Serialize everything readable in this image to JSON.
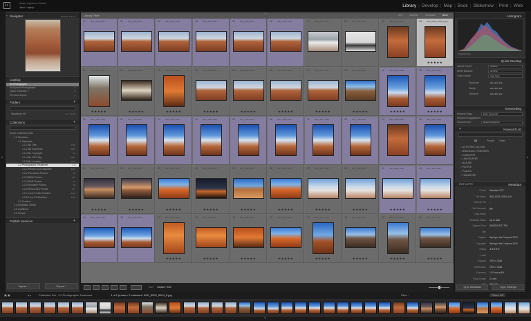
{
  "identity": {
    "user": "Adobe Lightroom Classic",
    "plate": "Jack Laptop"
  },
  "modules": {
    "items": [
      {
        "label": "Library",
        "active": true
      },
      {
        "label": "Develop",
        "active": false
      },
      {
        "label": "Map",
        "active": false
      },
      {
        "label": "Book",
        "active": false
      },
      {
        "label": "Slideshow",
        "active": false
      },
      {
        "label": "Print",
        "active": false
      },
      {
        "label": "Web",
        "active": false
      }
    ]
  },
  "left": {
    "navigator": {
      "title": "Navigator",
      "zoom": [
        "FIT",
        "FILL",
        "1:1",
        "3:1"
      ]
    },
    "catalog": {
      "title": "Catalog",
      "items": [
        {
          "label": "All Photographs",
          "count": "11034"
        },
        {
          "label": "All Synced Photographs",
          "count": "0"
        },
        {
          "label": "Quick Collection +",
          "count": "0"
        },
        {
          "label": "Previous Import",
          "count": "0"
        }
      ]
    },
    "folders": {
      "title": "Folders",
      "volume": "Macintosh HD",
      "volume_info": "1.4 / 1.9 TB"
    },
    "collections": {
      "title": "Collections",
      "items": [
        {
          "label": "Smart Collection Sets",
          "count": ""
        },
        {
          "label": "1.0 Workflow",
          "count": ""
        },
        {
          "label": "1.1 Metadata",
          "count": ""
        },
        {
          "label": "1.1.1 No Title",
          "count": "4459"
        },
        {
          "label": "1.1.2 No Keywords",
          "count": "2057"
        },
        {
          "label": "1.1.3 No Copyright",
          "count": "25"
        },
        {
          "label": "1.1.4 No GPS Tag",
          "count": "1904"
        },
        {
          "label": "1.1.5 No Location",
          "count": "1893"
        },
        {
          "label": "1.2 Photographic Treatment",
          "count": "1.0"
        },
        {
          "label": "1.2.1 Photos to be adjusted",
          "count": "3211"
        },
        {
          "label": "1.2.2 Panorama Photos",
          "count": "56"
        },
        {
          "label": "1.2.3 B&W Photos",
          "count": "482"
        },
        {
          "label": "1.2.4 HDR Photos",
          "count": "35"
        },
        {
          "label": "1.2.5 Selective Photos",
          "count": "58"
        },
        {
          "label": "1.2.6 Retouched Photos",
          "count": "107"
        },
        {
          "label": "1.2.7 Lens Profile Enabled",
          "count": "4316"
        },
        {
          "label": "1.2.8 Lens CA Enabled",
          "count": "4316"
        },
        {
          "label": "1.3 Creative",
          "count": ""
        },
        {
          "label": "2.0 Animation Series",
          "count": ""
        },
        {
          "label": "3.0 Locations",
          "count": ""
        },
        {
          "label": "4.0 People",
          "count": ""
        }
      ]
    },
    "publish": {
      "title": "Publish Services"
    },
    "import_label": "Import...",
    "export_label": "Export..."
  },
  "center": {
    "header": "Library Filter :",
    "filter_tabs": [
      "Text",
      "Attribute",
      "Metadata",
      "None"
    ],
    "active_filter": "None",
    "sort_label": "Sort:",
    "sort_value": "Capture Time"
  },
  "right": {
    "histogram": {
      "title": "Histogram",
      "original": "Original Photo"
    },
    "quick_develop": {
      "title": "Quick Develop",
      "rows": [
        {
          "label": "Saved Preset",
          "value": "Custom"
        },
        {
          "label": "White Balance",
          "value": "As Shot"
        },
        {
          "label": "Tone Control",
          "value": "Auto Tone"
        }
      ],
      "controls": [
        "Exposure",
        "Clarity",
        "Vibrance"
      ]
    },
    "keywording": {
      "title": "Keywording",
      "rows": [
        {
          "label": "Keyword Tags",
          "value": "Enter Keywords"
        },
        {
          "label": "Keyword Suggestions",
          "value": ""
        },
        {
          "label": "Keyword Set",
          "value": "Recent Keywords"
        }
      ]
    },
    "keyword_list": {
      "title": "Keyword List",
      "filter_tabs": [
        "All",
        "People",
        "Other"
      ],
      "items": [
        "ACTIVITIES / ACTION",
        "BUILDINGS / FEATURES",
        "CONCEPTS",
        "LANDSCAPES",
        "NATURE",
        "PEOPLE",
        "PLACES",
        "TRANSPORT"
      ]
    },
    "metadata": {
      "title": "Metadata",
      "preset_label": "EXIF & IPTC",
      "preset": "Default",
      "rows": [
        {
          "label": "Preset",
          "value": "Standard XTC"
        },
        {
          "label": "File Name",
          "value": "IMG_5203_5204_6.tif"
        },
        {
          "label": "Sidecar File",
          "value": "..."
        },
        {
          "label": "File Extension",
          "value": "jpg"
        },
        {
          "label": "Copy Name",
          "value": ""
        },
        {
          "label": "Metadata Status",
          "value": "Up to date"
        },
        {
          "label": "Capture Time",
          "value": "8/9/2018 8:27 PM"
        },
        {
          "label": "Title",
          "value": ""
        },
        {
          "label": "Caption",
          "value": "Spring in the Canyons 2019"
        },
        {
          "label": "Copyright",
          "value": "Spring in the Canyons 2019"
        },
        {
          "label": "Rating",
          "value": "★★★★★"
        },
        {
          "label": "Label",
          "value": ""
        },
        {
          "label": "Cropped",
          "value": "2978 x 3338"
        },
        {
          "label": "Dimensions",
          "value": "2978 x 3338"
        },
        {
          "label": "Exposure",
          "value": "1/10 sec at f/8"
        },
        {
          "label": "Focal Length",
          "value": "24 mm"
        },
        {
          "label": "ISO",
          "value": "ISO 100"
        }
      ]
    },
    "sync_metadata": "Sync Metadata",
    "sync_settings": "Sync Settings"
  },
  "filmstrip": {
    "source": "Collection Set : 1.2 Photographic Treatment",
    "selection": "1 of 2 photos / 1 selected / IMG_5203_5204_6.jpg",
    "filter_label": "Filter :",
    "filter_value": "Filters Off"
  },
  "grid_cells": [
    {
      "n": "01",
      "f": "IMG_2025.CR2",
      "stars": "",
      "t": "land",
      "p": "p-canyon",
      "sel": true,
      "cur": false
    },
    {
      "n": "02",
      "f": "IMG_2026.CR2",
      "stars": "",
      "t": "land",
      "p": "p-canyon",
      "sel": true,
      "cur": false
    },
    {
      "n": "03",
      "f": "IMG_2027.CR2",
      "stars": "",
      "t": "land",
      "p": "p-canyon",
      "sel": true,
      "cur": false
    },
    {
      "n": "04",
      "f": "IMG_2028.CR2",
      "stars": "",
      "t": "land",
      "p": "p-canyon",
      "sel": true,
      "cur": false
    },
    {
      "n": "05",
      "f": "IMG_2029.CR2",
      "stars": "",
      "t": "land",
      "p": "p-canyon",
      "sel": true,
      "cur": false
    },
    {
      "n": "06",
      "f": "IMG_2030.CR2",
      "stars": "",
      "t": "land",
      "p": "p-canyon",
      "sel": true,
      "cur": false
    },
    {
      "n": "07",
      "f": "IMG_2031.CR2",
      "stars": "",
      "t": "land",
      "p": "p-snow",
      "sel": false,
      "cur": false
    },
    {
      "n": "08",
      "f": "IMG_2032.CR2",
      "stars": "",
      "t": "land",
      "p": "p-snowd",
      "sel": false,
      "cur": false
    },
    {
      "n": "09",
      "f": "IMG_2033.CR2",
      "stars": "",
      "t": "port",
      "p": "p-rust",
      "sel": false,
      "cur": false
    },
    {
      "n": "10",
      "f": "IMG_5203_5204_6.jpg",
      "stars": "★★★★★",
      "t": "port",
      "p": "p-rust",
      "sel": false,
      "cur": true
    },
    {
      "n": "11",
      "f": "IMG_2035.CR2",
      "stars": "★★★★★",
      "t": "port",
      "p": "p-tree",
      "sel": false,
      "cur": false
    },
    {
      "n": "12",
      "f": "IMG_2036.CR2",
      "stars": "★★★★★",
      "t": "land",
      "p": "p-dark",
      "sel": false,
      "cur": false
    },
    {
      "n": "13",
      "f": "IMG_2037.CR2",
      "stars": "★★★★★",
      "t": "port",
      "p": "p-orange",
      "sel": false,
      "cur": false
    },
    {
      "n": "14",
      "f": "IMG_2038.CR2",
      "stars": "★★★★★",
      "t": "land",
      "p": "p-canyon",
      "sel": false,
      "cur": false
    },
    {
      "n": "15",
      "f": "IMG_2039.CR2",
      "stars": "★★★★★",
      "t": "land",
      "p": "p-canyon",
      "sel": false,
      "cur": false
    },
    {
      "n": "16",
      "f": "IMG_2040.CR2",
      "stars": "★★★★★",
      "t": "land",
      "p": "p-canyon",
      "sel": false,
      "cur": false
    },
    {
      "n": "17",
      "f": "IMG_2041.CR2",
      "stars": "★★★★★",
      "t": "land",
      "p": "p-canyon",
      "sel": false,
      "cur": false
    },
    {
      "n": "18",
      "f": "IMG_2042.CR2",
      "stars": "★★★★★",
      "t": "land",
      "p": "p-rock",
      "sel": false,
      "cur": false
    },
    {
      "n": "19",
      "f": "IMG_2043.CR2",
      "stars": "★★★★★",
      "t": "port",
      "p": "p-sky",
      "sel": true,
      "cur": false
    },
    {
      "n": "20",
      "f": "IMG_2044.CR2",
      "stars": "★★★★★",
      "t": "port",
      "p": "p-sky",
      "sel": true,
      "cur": false
    },
    {
      "n": "21",
      "f": "IMG_2045.CR2",
      "stars": "",
      "t": "port",
      "p": "p-skyP",
      "sel": true,
      "cur": false
    },
    {
      "n": "22",
      "f": "IMG_2046.CR2",
      "stars": "",
      "t": "port",
      "p": "p-skyP",
      "sel": true,
      "cur": false
    },
    {
      "n": "23",
      "f": "IMG_2047.CR2",
      "stars": "",
      "t": "port",
      "p": "p-skyP",
      "sel": true,
      "cur": false
    },
    {
      "n": "24",
      "f": "IMG_2048.CR2",
      "stars": "",
      "t": "port",
      "p": "p-skyP",
      "sel": true,
      "cur": false
    },
    {
      "n": "25",
      "f": "IMG_2049.CR2",
      "stars": "",
      "t": "port",
      "p": "p-skyP",
      "sel": true,
      "cur": false
    },
    {
      "n": "26",
      "f": "IMG_2050.CR2",
      "stars": "",
      "t": "port",
      "p": "p-skyP",
      "sel": true,
      "cur": false
    },
    {
      "n": "27",
      "f": "IMG_2051.CR2",
      "stars": "",
      "t": "port",
      "p": "p-skyP",
      "sel": true,
      "cur": false
    },
    {
      "n": "28",
      "f": "IMG_2052.CR2",
      "stars": "",
      "t": "port",
      "p": "p-skyP",
      "sel": true,
      "cur": false
    },
    {
      "n": "29",
      "f": "IMG_2053.CR2",
      "stars": "",
      "t": "port",
      "p": "p-rust",
      "sel": true,
      "cur": false
    },
    {
      "n": "30",
      "f": "IMG_2054.CR2",
      "stars": "",
      "t": "port",
      "p": "p-skyP",
      "sel": true,
      "cur": false
    },
    {
      "n": "31",
      "f": "IMG_2055.CR2",
      "stars": "★★★★★",
      "t": "land",
      "p": "p-dusk",
      "sel": false,
      "cur": false
    },
    {
      "n": "32",
      "f": "IMG_2056.CR2",
      "stars": "★★★★★",
      "t": "land",
      "p": "p-sunset",
      "sel": false,
      "cur": false
    },
    {
      "n": "33",
      "f": "IMG_2057.CR2",
      "stars": "★★★★★",
      "t": "land",
      "p": "p-arch",
      "sel": false,
      "cur": false
    },
    {
      "n": "34",
      "f": "IMG_2058.CR2",
      "stars": "★★★★★",
      "t": "land",
      "p": "p-night",
      "sel": false,
      "cur": false
    },
    {
      "n": "35",
      "f": "IMG_2059.CR2",
      "stars": "★★★★★",
      "t": "land",
      "p": "p-sand",
      "sel": false,
      "cur": false
    },
    {
      "n": "36",
      "f": "IMG_2060.CR2",
      "stars": "★★★★★",
      "t": "land",
      "p": "p-arch",
      "sel": false,
      "cur": false
    },
    {
      "n": "37",
      "f": "IMG_2061.CR2",
      "stars": "★★★★★",
      "t": "land",
      "p": "p-pale",
      "sel": false,
      "cur": false
    },
    {
      "n": "38",
      "f": "IMG_2062.CR2",
      "stars": "★★★★★",
      "t": "land",
      "p": "p-pale",
      "sel": false,
      "cur": false
    },
    {
      "n": "39",
      "f": "IMG_2063.CR2",
      "stars": "★★★★★",
      "t": "land",
      "p": "p-pale",
      "sel": true,
      "cur": false
    },
    {
      "n": "40",
      "f": "IMG_2064.CR2",
      "stars": "★★★★★",
      "t": "land",
      "p": "p-pale",
      "sel": true,
      "cur": false
    },
    {
      "n": "41",
      "f": "IMG_2065.CR2",
      "stars": "",
      "t": "land",
      "p": "p-sky",
      "sel": true,
      "cur": false
    },
    {
      "n": "42",
      "f": "IMG_2066.CR2",
      "stars": "",
      "t": "land",
      "p": "p-sky",
      "sel": true,
      "cur": false
    },
    {
      "n": "43",
      "f": "IMG_2067.CR2",
      "stars": "★★★★★",
      "t": "port",
      "p": "p-orng2",
      "sel": false,
      "cur": false
    },
    {
      "n": "44",
      "f": "IMG_2068.CR2",
      "stars": "★★★★★",
      "t": "land",
      "p": "p-orng2",
      "sel": false,
      "cur": false
    },
    {
      "n": "45",
      "f": "IMG_2069.CR2",
      "stars": "★★★★★",
      "t": "land",
      "p": "p-orange",
      "sel": false,
      "cur": false
    },
    {
      "n": "46",
      "f": "IMG_2070.CR2",
      "stars": "★★★★★",
      "t": "land",
      "p": "p-arch",
      "sel": false,
      "cur": false
    },
    {
      "n": "47",
      "f": "IMG_2071.CR2",
      "stars": "★★★★★",
      "t": "port",
      "p": "p-hoodoo",
      "sel": false,
      "cur": false
    },
    {
      "n": "48",
      "f": "IMG_2072.CR2",
      "stars": "★★★★★",
      "t": "land",
      "p": "p-wreck",
      "sel": false,
      "cur": false
    },
    {
      "n": "49",
      "f": "IMG_2073.CR2",
      "stars": "★★★★★",
      "t": "port",
      "p": "p-wreck",
      "sel": false,
      "cur": false
    },
    {
      "n": "50",
      "f": "IMG_2074.CR2",
      "stars": "★★★★★",
      "t": "land",
      "p": "p-wreck",
      "sel": false,
      "cur": false
    }
  ],
  "filmstrip_palettes": [
    "p-canyon",
    "p-canyon",
    "p-canyon",
    "p-canyon",
    "p-canyon",
    "p-canyon",
    "p-snow",
    "p-snowd",
    "p-rust",
    "p-rust",
    "p-tree",
    "p-dark",
    "p-orange",
    "p-canyon",
    "p-canyon",
    "p-canyon",
    "p-canyon",
    "p-rock",
    "p-sky",
    "p-sky",
    "p-skyP",
    "p-skyP",
    "p-skyP",
    "p-skyP",
    "p-skyP",
    "p-skyP",
    "p-skyP",
    "p-skyP",
    "p-rust",
    "p-skyP",
    "p-dusk",
    "p-sunset",
    "p-arch",
    "p-night",
    "p-sand",
    "p-arch",
    "p-pale",
    "p-pale"
  ],
  "colors": {
    "selected_cell": "#847d9f",
    "active_cell": "#bdbdbd",
    "grid_bg": "#6e6e6e",
    "panel_bg": "#313131"
  }
}
